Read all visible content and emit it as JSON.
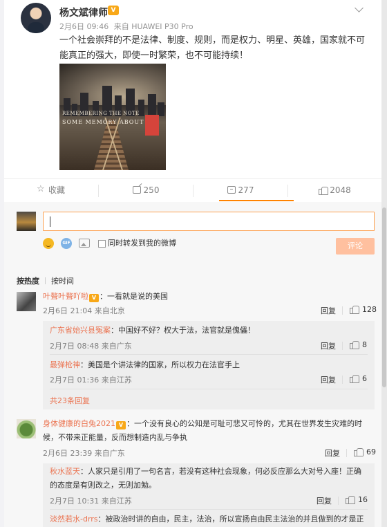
{
  "post": {
    "author": "杨文斌律师",
    "vip_badge": "V",
    "date": "2月6日 09:46",
    "source": "来自 HUAWEI P30 Pro",
    "text": "一个社会崇拜的不是法律、制度、规则，而是权力、明星、英雄，国家就不可能真正的强大，即使一时繁荣，也不可能持续！",
    "image_text_1": "REMEMBERING THE NOTE",
    "image_text_2": "SOME MEMORY  ABOUT"
  },
  "actions": {
    "favorite_label": "收藏",
    "repost_count": "250",
    "comment_count": "277",
    "like_count": "2048"
  },
  "composer": {
    "input_value": "",
    "repost_checkbox_label": "同时转发到我的微博",
    "submit_label": "评论",
    "gif_label": "GIF"
  },
  "sort": {
    "hot": "按热度",
    "time": "按时间"
  },
  "comments": [
    {
      "user": "叶聱叶聱吖啦",
      "text": "：一看就是说的美国",
      "meta": "2月6日 21:04 来自北京",
      "reply_label": "回复",
      "likes": "128",
      "replies": [
        {
          "user": "广东省始兴县冤案",
          "text": "：中国好不好？权大于法，法官就是傀儡！",
          "meta": "2月7日 08:48 来自广东",
          "reply_label": "回复",
          "likes": "8"
        },
        {
          "user": "最弹枪神",
          "text": "：美国是个讲法律的国家，所以权力在法官手上",
          "meta": "2月7日 01:36 来自江苏",
          "reply_label": "回复",
          "likes": "6"
        }
      ],
      "more_replies": "共23条回复"
    },
    {
      "user": "身体健康的白兔2021",
      "text_line1": "：一个没有良心的公知是可耻可悲又可怜的，尤其在世界发生灾难的时",
      "text_line2": "候，不带来正能量，反而想制造内乱与争执",
      "meta": "2月6日 23:39 来自广东",
      "reply_label": "回复",
      "likes": "69",
      "replies": [
        {
          "user": "秋水蓝天",
          "text_line1": "：人家只是引用了一句名言，若没有这种社会现象，何必反应那么大对号入座！正确",
          "text_line2": "的态度是有则改之，无则加勉。",
          "meta": "2月7日 10:31 来自江苏",
          "reply_label": "回复",
          "likes": "16"
        },
        {
          "user": "淡然若水-drrs",
          "text": "：被政治时讲的自由，民主，法治，所以宣扬自由民主法治的并且做到的才是正"
        }
      ]
    }
  ]
}
